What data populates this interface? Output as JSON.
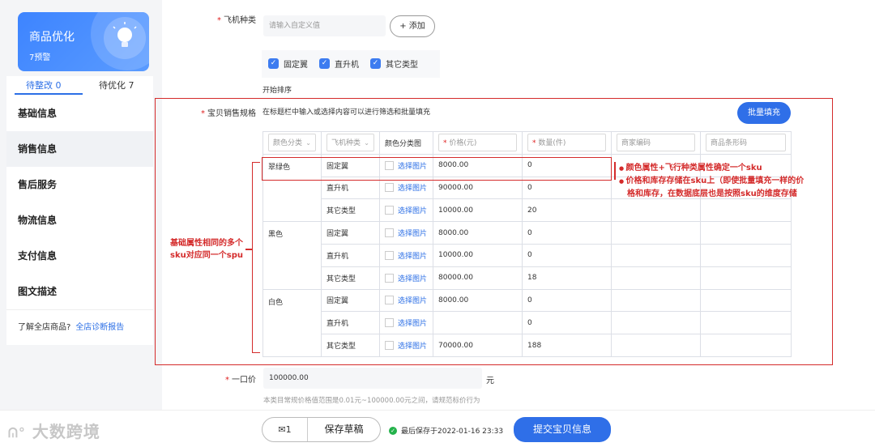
{
  "sidebar": {
    "card": {
      "title": "商品优化",
      "subtitle": "7预警"
    },
    "tabs": [
      {
        "label": "待整改 0"
      },
      {
        "label": "待优化 7"
      }
    ],
    "nav": [
      {
        "label": "基础信息"
      },
      {
        "label": "销售信息"
      },
      {
        "label": "售后服务"
      },
      {
        "label": "物流信息"
      },
      {
        "label": "支付信息"
      },
      {
        "label": "图文描述"
      }
    ],
    "footer": {
      "text": "了解全店商品?",
      "link": "全店诊断报告"
    }
  },
  "form": {
    "plane_type": {
      "label": "飞机种类",
      "input_placeholder": "请输入自定义值",
      "add_button": "+ 添加",
      "options": [
        {
          "label": "固定翼"
        },
        {
          "label": "直升机"
        },
        {
          "label": "其它类型"
        }
      ],
      "sort_text": "开始排序"
    },
    "sku": {
      "label": "宝贝销售规格",
      "hint": "在标题栏中输入或选择内容可以进行筛选和批量填充",
      "batch_fill": "批量填充",
      "headers": [
        "颜色分类",
        "飞机种类",
        "颜色分类图",
        "价格(元)",
        "数量(件)",
        "商家编码",
        "商品条形码"
      ],
      "select_image": "选择图片",
      "rows": [
        {
          "color": "翠绿色",
          "type": "固定翼",
          "price": "8000.00",
          "qty": "0"
        },
        {
          "color": "",
          "type": "直升机",
          "price": "90000.00",
          "qty": "0"
        },
        {
          "color": "",
          "type": "其它类型",
          "price": "10000.00",
          "qty": "20"
        },
        {
          "color": "黑色",
          "type": "固定翼",
          "price": "8000.00",
          "qty": "0"
        },
        {
          "color": "",
          "type": "直升机",
          "price": "10000.00",
          "qty": "0"
        },
        {
          "color": "",
          "type": "其它类型",
          "price": "80000.00",
          "qty": "18"
        },
        {
          "color": "白色",
          "type": "固定翼",
          "price": "8000.00",
          "qty": "0"
        },
        {
          "color": "",
          "type": "直升机",
          "price": "",
          "qty": "0"
        },
        {
          "color": "",
          "type": "其它类型",
          "price": "70000.00",
          "qty": "188"
        }
      ]
    },
    "price": {
      "label": "一口价",
      "value": "100000.00",
      "unit": "元",
      "hint": "本类目常规价格值范围是0.01元~100000.00元之间，请规范标价行为"
    }
  },
  "annotations": {
    "left_line1": "基础属性相同的多个",
    "left_line2": "sku对应同一个spu",
    "right_line1": "颜色属性+飞行种类属性确定一个sku",
    "right_line2": "价格和库存存储在sku上（即使批量填充一样的价",
    "right_line3": "格和库存，在数据底层也是按照sku的维度存储"
  },
  "bottom": {
    "draft_count": "1",
    "save_draft": "保存草稿",
    "last_saved": "最后保存于2022-01-16 23:33",
    "submit": "提交宝贝信息",
    "watermark": "大数跨境"
  },
  "colors": {
    "accent": "#2f6fe8",
    "annotation": "#d42b2b",
    "success": "#24b24b"
  }
}
